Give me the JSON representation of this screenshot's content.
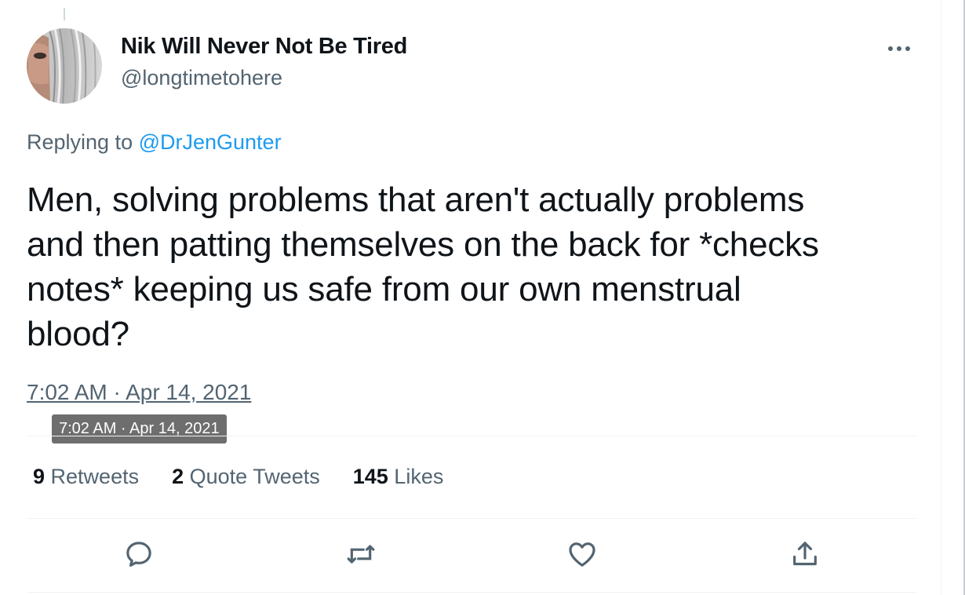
{
  "tweet": {
    "display_name": "Nik Will Never Not Be Tired",
    "handle": "@longtimetohere",
    "replying_prefix": "Replying to ",
    "replying_to": "@DrJenGunter",
    "text": "Men, solving problems that aren't actually problems\nand then patting themselves on the back for *checks\nnotes* keeping us safe from our own menstrual\nblood?",
    "timestamp": "7:02 AM · Apr 14, 2021",
    "tooltip": "7:02 AM · Apr 14, 2021"
  },
  "stats": {
    "retweets": {
      "count": "9",
      "label": " Retweets"
    },
    "quote_tweets": {
      "count": "2",
      "label": " Quote Tweets"
    },
    "likes": {
      "count": "145",
      "label": " Likes"
    }
  },
  "actions": {
    "reply_icon": "reply-icon",
    "retweet_icon": "retweet-icon",
    "like_icon": "heart-icon",
    "share_icon": "share-icon",
    "more_icon": "more-icon"
  },
  "colors": {
    "text_primary": "#0f1419",
    "text_secondary": "#536471",
    "link": "#1d9bf0",
    "divider": "#eff3f4",
    "tooltip_bg": "#6e6e6e"
  }
}
